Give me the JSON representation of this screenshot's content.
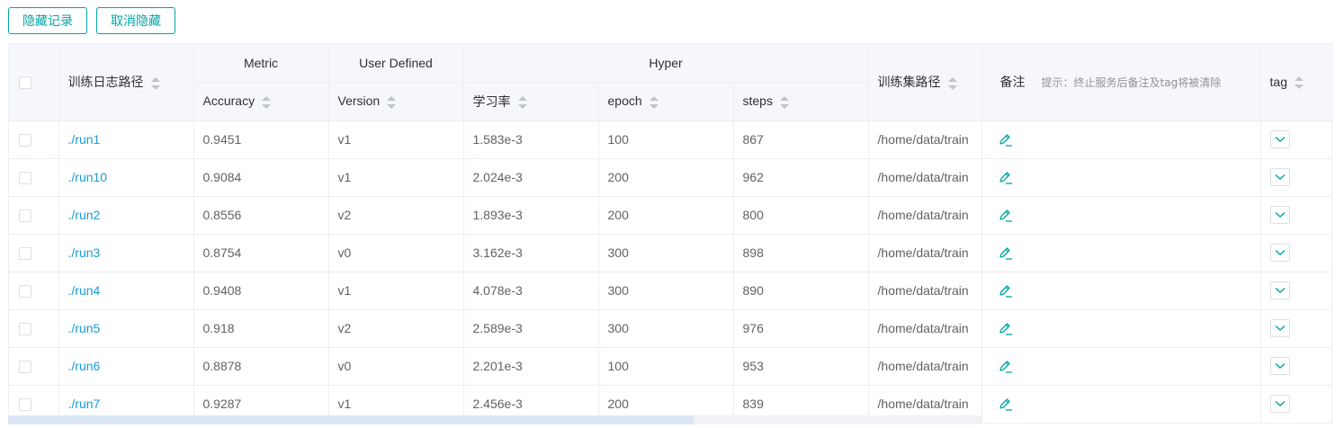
{
  "toolbar": {
    "hide_label": "隐藏记录",
    "unhide_label": "取消隐藏"
  },
  "header": {
    "log_path": "训练日志路径",
    "group_metric": "Metric",
    "group_user": "User Defined",
    "group_hyper": "Hyper",
    "accuracy": "Accuracy",
    "version": "Version",
    "lr": "学习率",
    "epoch": "epoch",
    "steps": "steps",
    "train_path": "训练集路径",
    "note": "备注",
    "note_hint": "提示：终止服务后备注及tag将被清除",
    "tag": "tag"
  },
  "rows": [
    {
      "run": "./run1",
      "acc": "0.9451",
      "ver": "v1",
      "lr": "1.583e-3",
      "epoch": "100",
      "steps": "867",
      "path": "/home/data/train"
    },
    {
      "run": "./run10",
      "acc": "0.9084",
      "ver": "v1",
      "lr": "2.024e-3",
      "epoch": "200",
      "steps": "962",
      "path": "/home/data/train"
    },
    {
      "run": "./run2",
      "acc": "0.8556",
      "ver": "v2",
      "lr": "1.893e-3",
      "epoch": "200",
      "steps": "800",
      "path": "/home/data/train"
    },
    {
      "run": "./run3",
      "acc": "0.8754",
      "ver": "v0",
      "lr": "3.162e-3",
      "epoch": "300",
      "steps": "898",
      "path": "/home/data/train"
    },
    {
      "run": "./run4",
      "acc": "0.9408",
      "ver": "v1",
      "lr": "4.078e-3",
      "epoch": "300",
      "steps": "890",
      "path": "/home/data/train"
    },
    {
      "run": "./run5",
      "acc": "0.918",
      "ver": "v2",
      "lr": "2.589e-3",
      "epoch": "300",
      "steps": "976",
      "path": "/home/data/train"
    },
    {
      "run": "./run6",
      "acc": "0.8878",
      "ver": "v0",
      "lr": "2.201e-3",
      "epoch": "100",
      "steps": "953",
      "path": "/home/data/train"
    },
    {
      "run": "./run7",
      "acc": "0.9287",
      "ver": "v1",
      "lr": "2.456e-3",
      "epoch": "200",
      "steps": "839",
      "path": "/home/data/train"
    }
  ],
  "colors": {
    "accent": "#00a5a7",
    "link": "#1a9bd7",
    "header_bg": "#f5f7fa",
    "border": "#ebeef5"
  }
}
